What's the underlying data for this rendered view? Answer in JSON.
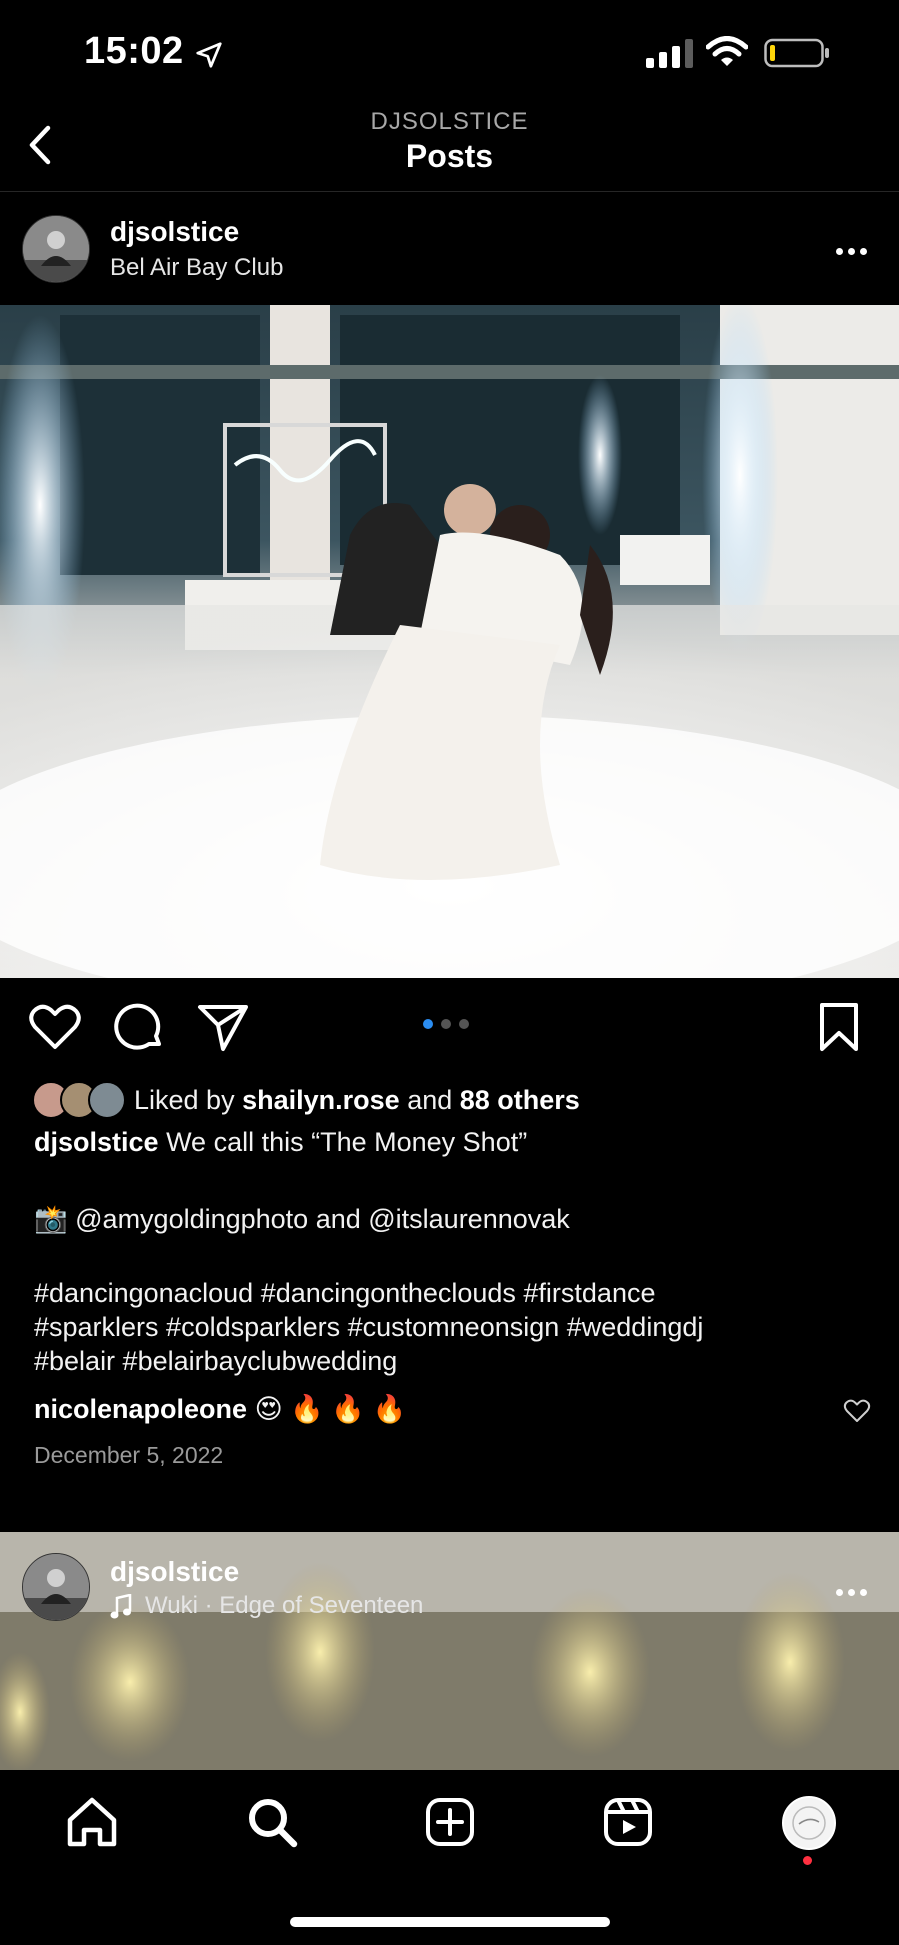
{
  "status_bar": {
    "time": "15:02"
  },
  "header": {
    "account": "DJSOLSTICE",
    "title": "Posts"
  },
  "post1": {
    "username": "djsolstice",
    "location": "Bel Air Bay Club",
    "likes": {
      "prefix": "Liked by",
      "user": "shailyn.rose",
      "middle": "and",
      "others": "88 others"
    },
    "caption": {
      "author": "djsolstice",
      "text": "We call this “The Money Shot”",
      "credit_emoji": "📸",
      "credit": "@amygoldingphoto and @itslaurennovak",
      "hashtags_line1": "#dancingonacloud #dancingontheclouds #firstdance",
      "hashtags_line2": "#sparklers #coldsparklers #customneonsign #weddingdj",
      "hashtags_line3": "#belair #belairbayclubwedding"
    },
    "comment": {
      "user": "nicolenapoleone",
      "text": "😍 🔥 🔥 🔥"
    },
    "date": "December 5, 2022",
    "carousel": {
      "count": 3,
      "active_index": 0
    }
  },
  "post2": {
    "username": "djsolstice",
    "audio_icon": "music-note-icon",
    "audio": "Wuki · Edge of Seventeen"
  },
  "tabbar": {
    "items": [
      "home-icon",
      "search-icon",
      "create-icon",
      "reels-icon",
      "profile-avatar"
    ]
  },
  "colors": {
    "accent": "#2b8df1",
    "notification": "#ff3040",
    "background": "#000000"
  }
}
